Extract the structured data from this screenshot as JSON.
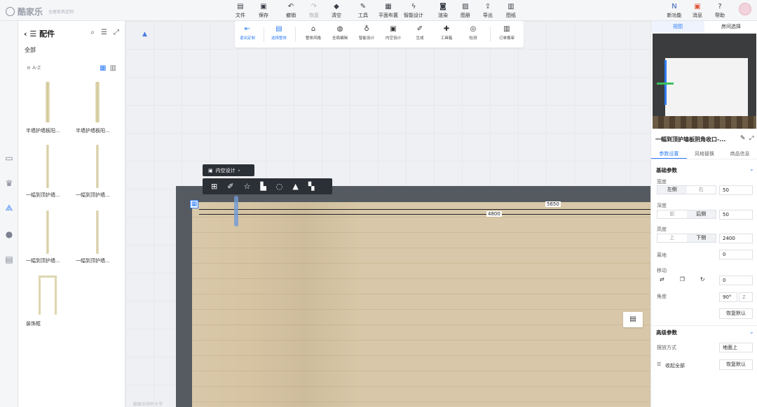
{
  "app": {
    "name": "酷家乐",
    "subtitle": "全屋家具定制"
  },
  "toolbar": {
    "items": [
      {
        "label": "文件",
        "icon": "file-icon"
      },
      {
        "label": "保存",
        "icon": "save-icon"
      },
      {
        "label": "撤销",
        "icon": "undo-icon"
      },
      {
        "label": "恢复",
        "icon": "redo-icon"
      },
      {
        "label": "清空",
        "icon": "eraser-icon"
      },
      {
        "label": "工具",
        "icon": "wrench-icon"
      },
      {
        "label": "平面布置",
        "icon": "layout-icon"
      },
      {
        "label": "智能设计",
        "icon": "lightning-icon"
      },
      {
        "label": "渲染",
        "icon": "camera-icon"
      },
      {
        "label": "图册",
        "icon": "gallery-icon"
      },
      {
        "label": "导出",
        "icon": "export-icon"
      },
      {
        "label": "图纸",
        "icon": "drawing-icon"
      }
    ],
    "right": [
      {
        "label": "新功能",
        "icon": "new-feature-icon"
      },
      {
        "label": "消息",
        "icon": "gift-icon"
      },
      {
        "label": "帮助",
        "icon": "help-icon"
      }
    ]
  },
  "panel": {
    "title": "配件",
    "all_label": "全部",
    "sort_label": "A-Z",
    "items": [
      {
        "label": "半墙护墙板阳..."
      },
      {
        "label": "半墙护墙板阳..."
      },
      {
        "label": "一幅到顶护墙..."
      },
      {
        "label": "一幅到顶护墙..."
      },
      {
        "label": "一幅到顶护墙..."
      },
      {
        "label": "一幅到顶护墙..."
      },
      {
        "label": "装饰框"
      }
    ]
  },
  "subtoolbar": {
    "items": [
      {
        "label": "退出定制",
        "icon": "exit-icon"
      },
      {
        "label": "选择整体",
        "icon": "select-all-icon"
      },
      {
        "label": "整体风格",
        "icon": "brush-icon"
      },
      {
        "label": "全局编辑",
        "icon": "globe-edit-icon"
      },
      {
        "label": "智能设计",
        "icon": "bulb-icon"
      },
      {
        "label": "内空设计",
        "icon": "inner-space-icon"
      },
      {
        "label": "生成",
        "icon": "generate-icon"
      },
      {
        "label": "工具箱",
        "icon": "puzzle-icon"
      },
      {
        "label": "检测",
        "icon": "check-icon"
      },
      {
        "label": "订单报审",
        "icon": "order-icon"
      }
    ]
  },
  "canvas": {
    "float_label": "内空设计",
    "dim_outer": "5650",
    "dim_inner": "4800"
  },
  "view3d": {
    "tabs": [
      "视图",
      "房间选择"
    ]
  },
  "props": {
    "title": "一幅到顶护墙板阴角收口-...",
    "tabs": [
      "参数设置",
      "风格替换",
      "商品信息"
    ],
    "basic_section": "基础参数",
    "width": {
      "label": "宽度",
      "seg": [
        "左侧",
        "右"
      ],
      "value": "50"
    },
    "depth": {
      "label": "深度",
      "seg": [
        "前",
        "后侧"
      ],
      "value": "50"
    },
    "height": {
      "label": "高度",
      "seg": [
        "上",
        "下侧"
      ],
      "value": "2400"
    },
    "elev": {
      "label": "离地",
      "value": "0"
    },
    "move": {
      "label": "移动",
      "value": "0"
    },
    "angle": {
      "label": "角度",
      "value": "90°",
      "axis": "Z"
    },
    "reset_label": "恢复默认",
    "adv_section": "高级参数",
    "place": {
      "label": "摆放方式",
      "value": "地面上"
    },
    "collapse_label": "收起全部",
    "reset2_label": "恢复默认"
  },
  "watermark": "酷家乐铁杆大学"
}
